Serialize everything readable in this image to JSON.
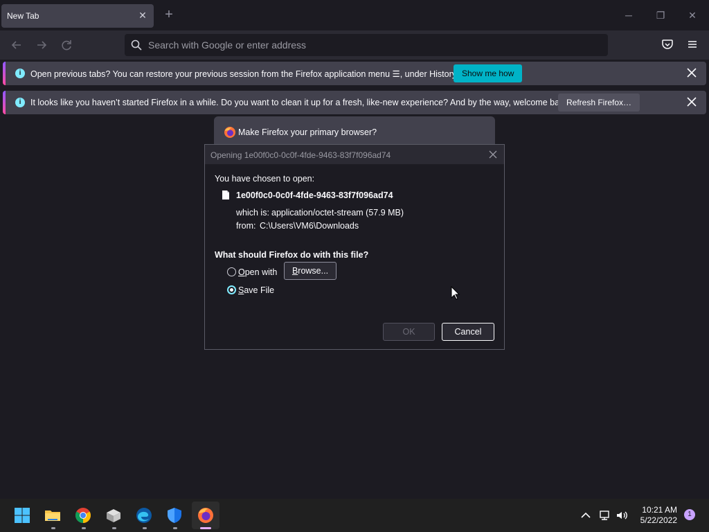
{
  "browser": {
    "tab_title": "New Tab",
    "tab_close": "✕",
    "new_tab": "+",
    "window_controls": {
      "minimize": "─",
      "restore": "❐",
      "close": "✕"
    },
    "url_placeholder": "Search with Google or enter address"
  },
  "notifications": [
    {
      "message": "Open previous tabs? You can restore your previous session from the Firefox application menu ☰, under History.",
      "button": "Show me how",
      "icon": "info-icon"
    },
    {
      "message": "It looks like you haven’t started Firefox in a while. Do you want to clean it up for a fresh, like-new experience? And by the way, welcome back!",
      "button": "Refresh Firefox…",
      "icon": "info-icon"
    }
  ],
  "primary_dialog": {
    "title": "Make Firefox your primary browser?"
  },
  "open_dialog": {
    "title": "Opening 1e00f0c0-0c0f-4fde-9463-83f7f096ad74",
    "chosen_text": "You have chosen to open:",
    "file_name": "1e00f0c0-0c0f-4fde-9463-83f7f096ad74",
    "which_is_label": "which is:",
    "which_is_value": "application/octet-stream (57.9 MB)",
    "from_label": "from:",
    "from_value": "C:\\Users\\VM6\\Downloads",
    "question": "What should Firefox do with this file?",
    "open_with_label": "Open with",
    "browse_label": "Browse...",
    "save_file_label": "Save File",
    "selected_option": "save_file",
    "ok_label": "OK",
    "cancel_label": "Cancel"
  },
  "taskbar": {
    "apps": [
      "windows-start-icon",
      "file-explorer-icon",
      "chrome-icon",
      "package-icon",
      "edge-icon",
      "defender-icon",
      "firefox-icon"
    ],
    "time": "10:21 AM",
    "date": "5/22/2022",
    "notification_count": "1"
  },
  "colors": {
    "accent_teal": "#00b3c7",
    "focus_ring": "#80ebff",
    "background": "#1c1b22"
  }
}
